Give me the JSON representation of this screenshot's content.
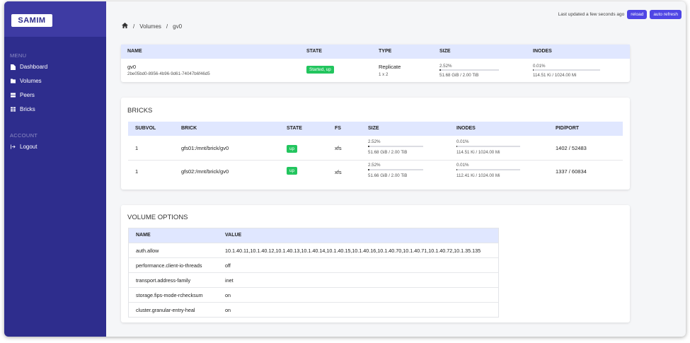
{
  "app": {
    "logo": "SAMIM"
  },
  "sidebar": {
    "menu_label": "MENU",
    "items": [
      {
        "label": "Dashboard",
        "icon": "file-icon"
      },
      {
        "label": "Volumes",
        "icon": "folder-icon"
      },
      {
        "label": "Peers",
        "icon": "server-icon"
      },
      {
        "label": "Bricks",
        "icon": "grid-icon"
      }
    ],
    "account_label": "ACCOUNT",
    "logout": "Logout"
  },
  "topbar": {
    "last_updated": "Last updated a few seconds ago",
    "reload": "reload",
    "auto_refresh": "auto refresh"
  },
  "breadcrumb": {
    "sep": "/",
    "volumes": "Volumes",
    "current": "gv0"
  },
  "volume": {
    "headers": {
      "name": "NAME",
      "state": "STATE",
      "type": "TYPE",
      "size": "SIZE",
      "inodes": "INODES"
    },
    "name": "gv0",
    "id": "2be05bd0-8956-4b96-9d61-74047b6f46d5",
    "state": "Started, up",
    "type": "Replicate",
    "type_sub": "1 x 2",
    "size_pct": "2.52%",
    "size_fraction": 0.0252,
    "size_detail": "51.68 GiB / 2.00 TiB",
    "inodes_pct": "0.01%",
    "inodes_fraction": 0.0001,
    "inodes_detail": "114.51 Ki / 1024.00 Mi"
  },
  "bricks": {
    "title": "BRICKS",
    "headers": {
      "subvol": "SUBVOL",
      "brick": "BRICK",
      "state": "STATE",
      "fs": "FS",
      "size": "SIZE",
      "inodes": "INODES",
      "pid": "PID/PORT"
    },
    "rows": [
      {
        "subvol": "1",
        "brick": "gfs01:/mnt/brick/gv0",
        "state": "up",
        "fs": "xfs",
        "size_pct": "2.52%",
        "size_fraction": 0.0252,
        "size_detail": "51.68 GiB / 2.00 TiB",
        "inodes_pct": "0.01%",
        "inodes_fraction": 0.0001,
        "inodes_detail": "114.51 Ki / 1024.00 Mi",
        "pid": "1402 / 52483"
      },
      {
        "subvol": "1",
        "brick": "gfs02:/mnt/brick/gv0",
        "state": "up",
        "fs": "xfs",
        "size_pct": "2.52%",
        "size_fraction": 0.0252,
        "size_detail": "51.66 GiB / 2.00 TiB",
        "inodes_pct": "0.01%",
        "inodes_fraction": 0.0001,
        "inodes_detail": "112.41 Ki / 1024.00 Mi",
        "pid": "1337 / 60834"
      }
    ]
  },
  "options": {
    "title": "VOLUME OPTIONS",
    "headers": {
      "name": "NAME",
      "value": "VALUE"
    },
    "rows": [
      {
        "name": "auth.allow",
        "value": "10.1.40.11,10.1.40.12,10.1.40.13,10.1.40.14,10.1.40.15,10.1.40.16,10.1.40.70,10.1.40.71,10.1.40.72,10.1.35.135"
      },
      {
        "name": "performance.client-io-threads",
        "value": "off"
      },
      {
        "name": "transport.address-family",
        "value": "inet"
      },
      {
        "name": "storage.fips-mode-rchecksum",
        "value": "on"
      },
      {
        "name": "cluster.granular-entry-heal",
        "value": "on"
      }
    ]
  },
  "colors": {
    "sidebar": "#2e2d8d",
    "accent": "#4f46e5",
    "badge": "#22c55e",
    "table_header": "#e0e7ff"
  }
}
